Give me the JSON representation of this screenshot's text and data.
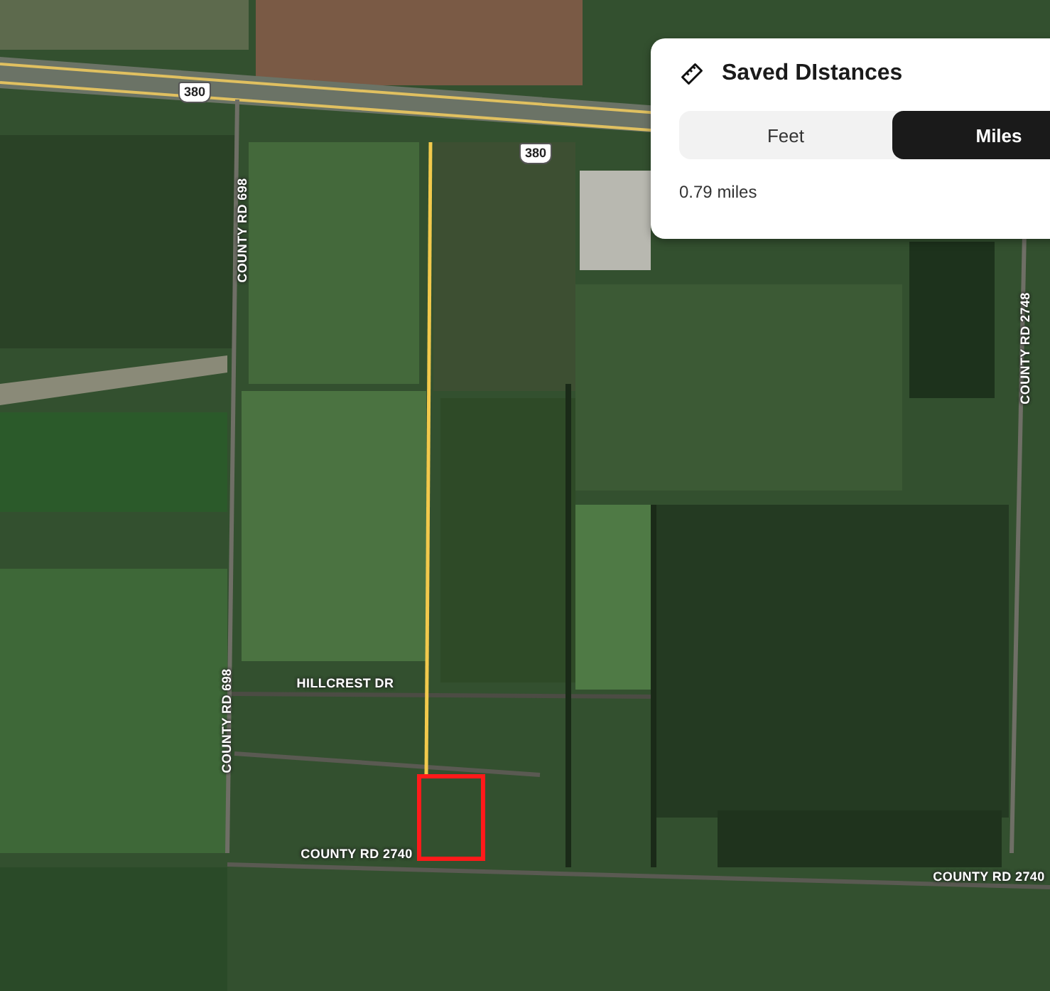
{
  "map": {
    "road_labels": [
      {
        "text": "380",
        "kind": "shield"
      },
      {
        "text": "380",
        "kind": "shield"
      },
      {
        "text": "COUNTY RD 698",
        "kind": "vertical"
      },
      {
        "text": "COUNTY RD 698",
        "kind": "vertical"
      },
      {
        "text": "COUNTY RD 2748",
        "kind": "vertical"
      },
      {
        "text": "HILLCREST DR",
        "kind": "horizontal"
      },
      {
        "text": "COUNTY RD 2740",
        "kind": "horizontal"
      },
      {
        "text": "COUNTY RD 2740",
        "kind": "horizontal"
      }
    ]
  },
  "panel": {
    "title": "Saved DIstances",
    "units": [
      {
        "label": "Feet",
        "selected": false
      },
      {
        "label": "Miles",
        "selected": true
      }
    ],
    "result": "0.79 miles"
  }
}
